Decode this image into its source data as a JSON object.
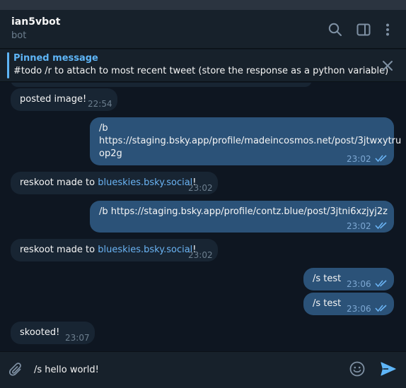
{
  "header": {
    "title": "ian5vbot",
    "status": "bot",
    "icons": [
      "search-icon",
      "sidebar-toggle-icon",
      "more-vertical-icon"
    ]
  },
  "pinned": {
    "title": "Pinned message",
    "text": "#todo /r to attach to most recent tweet (store the response as a python variable)",
    "close_icon": "close-icon"
  },
  "messages": [
    {
      "direction": "in",
      "text": "posted image!",
      "time": "22:54"
    },
    {
      "direction": "out",
      "lines": [
        "/b",
        "https://staging.bsky.app/profile/madeincosmos.net/post/3jtwxytru",
        "op2g"
      ],
      "time": "23:02",
      "read": true
    },
    {
      "direction": "in",
      "text_before": "reskoot made to ",
      "link": "blueskies.bsky.social",
      "text_after": "!",
      "time": "23:02"
    },
    {
      "direction": "out",
      "text": "/b https://staging.bsky.app/profile/contz.blue/post/3jtni6xzjyj2z",
      "time": "23:02",
      "read": true
    },
    {
      "direction": "in",
      "text_before": "reskoot made to ",
      "link": "blueskies.bsky.social",
      "text_after": "!",
      "time": "23:02"
    },
    {
      "direction": "out",
      "text": "/s test",
      "time": "23:06",
      "read": true
    },
    {
      "direction": "out",
      "text": "/s test",
      "time": "23:06",
      "read": true
    },
    {
      "direction": "in",
      "text": "skooted!",
      "time": "23:07"
    }
  ],
  "composer": {
    "value": "/s hello world!",
    "icons": [
      "attach-icon",
      "emoji-icon",
      "send-icon"
    ]
  },
  "colors": {
    "background": "#0e1621",
    "panel": "#17212b",
    "incoming_bubble": "#182533",
    "outgoing_bubble": "#2b5278",
    "accent": "#5eb5f7",
    "link": "#6ab3f3"
  }
}
